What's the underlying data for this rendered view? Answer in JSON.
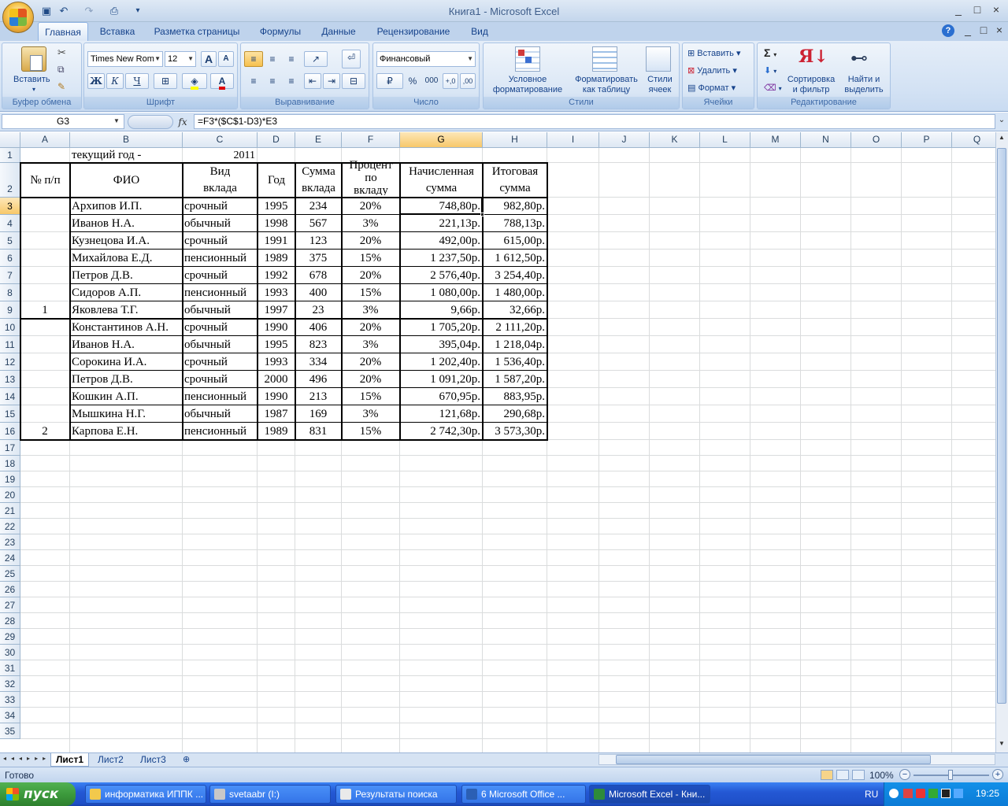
{
  "window": {
    "title": "Книга1 - Microsoft Excel",
    "controls": [
      "_",
      "□",
      "×"
    ],
    "ribbon_controls": [
      "?",
      "_",
      "□",
      "×"
    ]
  },
  "qat": {
    "icons": [
      "save-icon",
      "undo-icon",
      "redo-icon",
      "print-preview-icon",
      "customize-icon"
    ]
  },
  "tabs": [
    "Главная",
    "Вставка",
    "Разметка страницы",
    "Формулы",
    "Данные",
    "Рецензирование",
    "Вид"
  ],
  "active_tab": "Главная",
  "ribbon": {
    "clipboard": {
      "label": "Буфер обмена",
      "paste": "Вставить"
    },
    "font": {
      "label": "Шрифт",
      "family": "Times New Rom",
      "size": "12",
      "grow": "A",
      "shrink": "A",
      "bold": "Ж",
      "italic": "К",
      "underline": "Ч",
      "color_glyph": "A"
    },
    "alignment": {
      "label": "Выравнивание"
    },
    "number": {
      "label": "Число",
      "format": "Финансовый",
      "percent": "%",
      "thousands": "000"
    },
    "styles": {
      "label": "Стили",
      "conditional": [
        "Условное",
        "форматирование"
      ],
      "as_table": [
        "Форматировать",
        "как таблицу"
      ],
      "cell_styles": [
        "Стили",
        "ячеек"
      ]
    },
    "cells": {
      "label": "Ячейки",
      "insert": "Вставить",
      "delete": "Удалить",
      "format": "Формат"
    },
    "editing": {
      "label": "Редактирование",
      "sum": "Σ",
      "sort": [
        "Сортировка",
        "и фильтр"
      ],
      "find": [
        "Найти и",
        "выделить"
      ]
    }
  },
  "formula_bar": {
    "name_box": "G3",
    "fx": "fx",
    "formula": "=F3*($C$1-D3)*E3"
  },
  "columns": [
    "A",
    "B",
    "C",
    "D",
    "E",
    "F",
    "G",
    "H",
    "I",
    "J",
    "K",
    "L",
    "M",
    "N",
    "O",
    "P",
    "Q"
  ],
  "selected_column": "G",
  "row_numbers": [
    "1",
    "2",
    "3",
    "4",
    "5",
    "6",
    "7",
    "8",
    "9",
    "10",
    "11",
    "12",
    "13",
    "14",
    "15",
    "16",
    "17",
    "18",
    "19",
    "20",
    "21",
    "22",
    "23",
    "24",
    "25",
    "26",
    "27",
    "28",
    "29",
    "30",
    "31",
    "32",
    "33",
    "34",
    "35"
  ],
  "selected_row": "3",
  "sheet": {
    "row1": {
      "b": "текущий год -",
      "c": "2011"
    },
    "headers": {
      "a": [
        "№ п/п"
      ],
      "b": [
        "ФИО"
      ],
      "c": [
        "Вид",
        "вклада"
      ],
      "d": [
        "Год"
      ],
      "e": [
        "Сумма",
        "вклада"
      ],
      "f": [
        "Процент",
        "по",
        "вкладу"
      ],
      "g": [
        "Начисленная",
        "сумма"
      ],
      "h": [
        "Итоговая",
        "сумма"
      ]
    },
    "group_labels": [
      "1",
      "2"
    ],
    "rows": [
      [
        "Архипов И.П.",
        "срочный",
        "1995",
        "234",
        "20%",
        "748,80р.",
        "982,80р."
      ],
      [
        "Иванов Н.А.",
        "обычный",
        "1998",
        "567",
        "3%",
        "221,13р.",
        "788,13р."
      ],
      [
        "Кузнецова И.А.",
        "срочный",
        "1991",
        "123",
        "20%",
        "492,00р.",
        "615,00р."
      ],
      [
        "Михайлова Е.Д.",
        "пенсионный",
        "1989",
        "375",
        "15%",
        "1 237,50р.",
        "1 612,50р."
      ],
      [
        "Петров Д.В.",
        "срочный",
        "1992",
        "678",
        "20%",
        "2 576,40р.",
        "3 254,40р."
      ],
      [
        "Сидоров А.П.",
        "пенсионный",
        "1993",
        "400",
        "15%",
        "1 080,00р.",
        "1 480,00р."
      ],
      [
        "Яковлева Т.Г.",
        "обычный",
        "1997",
        "23",
        "3%",
        "9,66р.",
        "32,66р."
      ],
      [
        "Константинов А.Н.",
        "срочный",
        "1990",
        "406",
        "20%",
        "1 705,20р.",
        "2 111,20р."
      ],
      [
        "Иванов Н.А.",
        "обычный",
        "1995",
        "823",
        "3%",
        "395,04р.",
        "1 218,04р."
      ],
      [
        "Сорокина И.А.",
        "срочный",
        "1993",
        "334",
        "20%",
        "1 202,40р.",
        "1 536,40р."
      ],
      [
        "Петров Д.В.",
        "срочный",
        "2000",
        "496",
        "20%",
        "1 091,20р.",
        "1 587,20р."
      ],
      [
        "Кошкин А.П.",
        "пенсионный",
        "1990",
        "213",
        "15%",
        "670,95р.",
        "883,95р."
      ],
      [
        "Мышкина Н.Г.",
        "обычный",
        "1987",
        "169",
        "3%",
        "121,68р.",
        "290,68р."
      ],
      [
        "Карпова Е.Н.",
        "пенсионный",
        "1989",
        "831",
        "15%",
        "2 742,30р.",
        "3 573,30р."
      ]
    ]
  },
  "sheet_tabs": [
    "Лист1",
    "Лист2",
    "Лист3"
  ],
  "active_sheet": "Лист1",
  "status": {
    "text": "Готово",
    "zoom": "100%"
  },
  "taskbar": {
    "start": "пуск",
    "items": [
      "информатика ИППК ...",
      "svetaabr (I:)",
      "Результаты поиска",
      "6 Microsoft Office ...",
      "Microsoft Excel - Кни..."
    ],
    "active_item": "Microsoft Excel - Кни...",
    "lang": "RU",
    "clock": "19:25"
  }
}
